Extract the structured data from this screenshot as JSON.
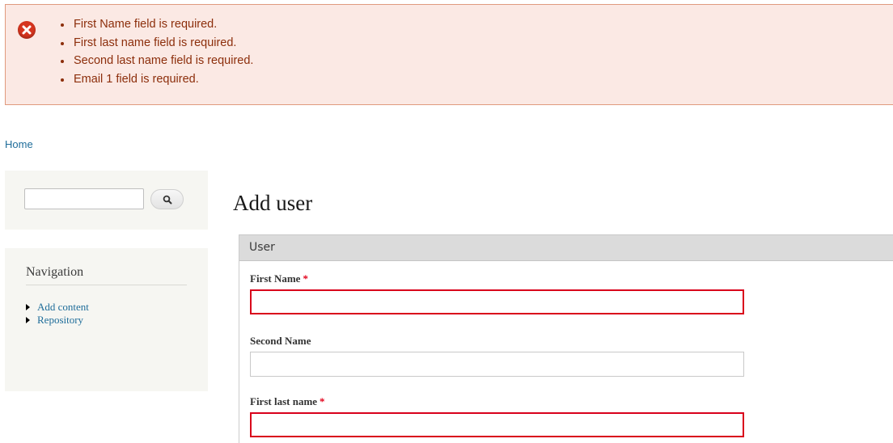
{
  "messages": {
    "errors": [
      "First Name field is required.",
      "First last name field is required.",
      "Second last name field is required.",
      "Email 1 field is required."
    ]
  },
  "breadcrumb": {
    "home": "Home"
  },
  "search": {
    "value": "",
    "button_icon": "magnifier-icon"
  },
  "navigation": {
    "title": "Navigation",
    "items": [
      {
        "label": "Add content"
      },
      {
        "label": "Repository"
      }
    ]
  },
  "page": {
    "title": "Add user"
  },
  "form": {
    "fieldset_legend": "User",
    "fields": [
      {
        "label": "First Name",
        "required_marker": "*",
        "value": ""
      },
      {
        "label": "Second Name",
        "value": ""
      },
      {
        "label": "First last name",
        "required_marker": "*",
        "value": ""
      }
    ]
  },
  "colors": {
    "error_background": "#fbe9e4",
    "error_text": "#8c2e0b",
    "link": "#1f6d9a",
    "required": "#e2001a",
    "error_border": "#d9001b"
  }
}
